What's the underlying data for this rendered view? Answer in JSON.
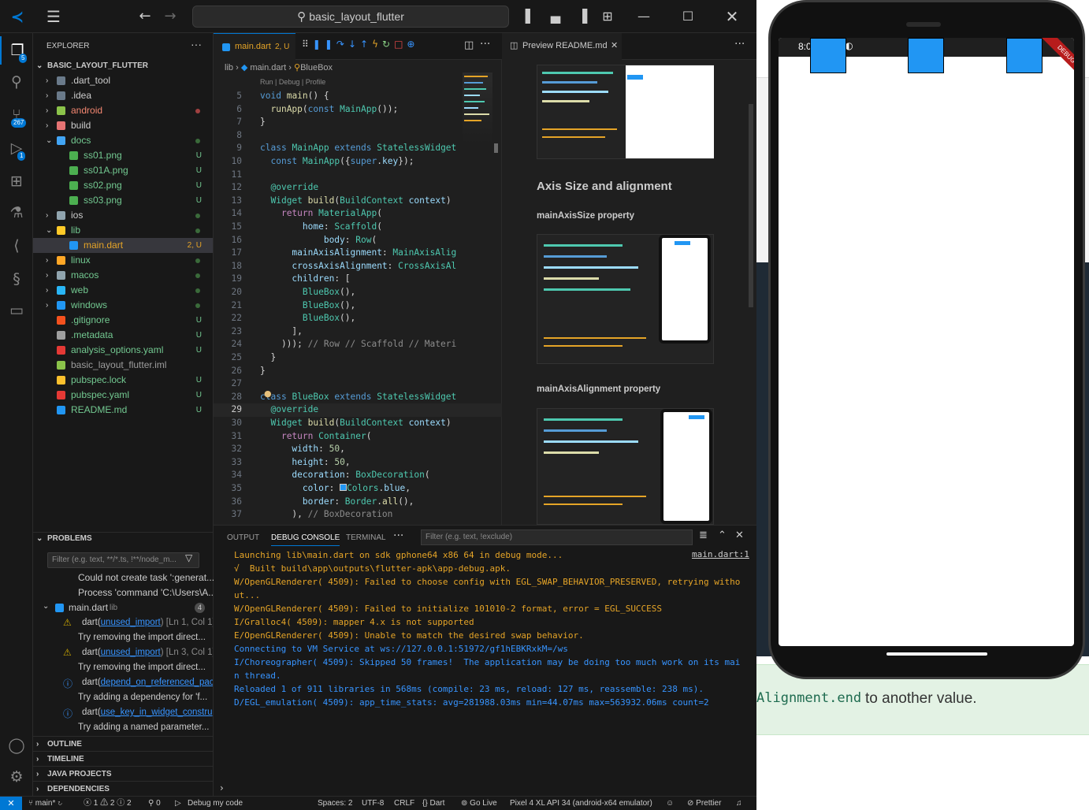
{
  "titlebar": {
    "search_text": "basic_layout_flutter"
  },
  "activity_badges": {
    "explorer": "5",
    "scm": "267",
    "debug": "1"
  },
  "explorer": {
    "header": "EXPLORER",
    "root": "BASIC_LAYOUT_FLUTTER",
    "items": [
      {
        "label": ".dart_tool",
        "status": ""
      },
      {
        "label": ".idea",
        "status": ""
      },
      {
        "label": "android",
        "status": ""
      },
      {
        "label": "build",
        "status": ""
      },
      {
        "label": "docs",
        "status": ""
      },
      {
        "label": "ss01.png",
        "status": "U"
      },
      {
        "label": "ss01A.png",
        "status": "U"
      },
      {
        "label": "ss02.png",
        "status": "U"
      },
      {
        "label": "ss03.png",
        "status": "U"
      },
      {
        "label": "ios",
        "status": ""
      },
      {
        "label": "lib",
        "status": ""
      },
      {
        "label": "main.dart",
        "status": "2, U"
      },
      {
        "label": "linux",
        "status": ""
      },
      {
        "label": "macos",
        "status": ""
      },
      {
        "label": "web",
        "status": ""
      },
      {
        "label": "windows",
        "status": ""
      },
      {
        "label": ".gitignore",
        "status": "U"
      },
      {
        "label": ".metadata",
        "status": "U"
      },
      {
        "label": "analysis_options.yaml",
        "status": "U"
      },
      {
        "label": "basic_layout_flutter.iml",
        "status": ""
      },
      {
        "label": "pubspec.lock",
        "status": "U"
      },
      {
        "label": "pubspec.yaml",
        "status": "U"
      },
      {
        "label": "README.md",
        "status": "U"
      }
    ]
  },
  "problems": {
    "header": "PROBLEMS",
    "filter_placeholder": "Filter (e.g. text, **/*.ts, !**/node_m...",
    "line1": "Could not create task ':generat...",
    "line2": "Process 'command 'C:\\Users\\A...",
    "file": "main.dart",
    "file_dir": "lib",
    "count": "4",
    "rows": [
      {
        "prefix": "dart(",
        "code": "unused_import",
        "suffix": ") [Ln 1, Col 1]"
      },
      {
        "text": "Try removing the import direct..."
      },
      {
        "prefix": "dart(",
        "code": "unused_import",
        "suffix": ") [Ln 3, Col 1]"
      },
      {
        "text": "Try removing the import direct..."
      },
      {
        "prefix": "dart(",
        "code": "depend_on_referenced_pac",
        "suffix": ""
      },
      {
        "text": "Try adding a dependency for 'f..."
      },
      {
        "prefix": "dart(",
        "code": "use_key_in_widget_constru",
        "suffix": ""
      },
      {
        "text": "Try adding a named parameter..."
      }
    ]
  },
  "bottom_sections": [
    "OUTLINE",
    "TIMELINE",
    "JAVA PROJECTS",
    "DEPENDENCIES"
  ],
  "editor": {
    "tab_label": "main.dart",
    "tab_status": "2, U",
    "breadcrumb": [
      "lib",
      "main.dart",
      "BlueBox"
    ],
    "codelens": "Run | Debug | Profile",
    "lines": [
      {
        "n": "5",
        "h": "<span class='kw'>void</span> <span class='fn'>main</span>() {"
      },
      {
        "n": "6",
        "h": "  <span class='fn'>runApp</span>(<span class='kw'>const</span> <span class='ty'>MainApp</span>());"
      },
      {
        "n": "7",
        "h": "}"
      },
      {
        "n": "8",
        "h": ""
      },
      {
        "n": "9",
        "h": "<span class='kw'>class</span> <span class='ty'>MainApp</span> <span class='kw'>extends</span> <span class='ty'>StatelessWidget</span>"
      },
      {
        "n": "10",
        "h": "  <span class='kw'>const</span> <span class='ty'>MainApp</span>({<span class='kw'>super</span>.<span class='pr'>key</span>});"
      },
      {
        "n": "11",
        "h": ""
      },
      {
        "n": "12",
        "h": "  <span class='ty'>@override</span>"
      },
      {
        "n": "13",
        "h": "  <span class='ty'>Widget</span> <span class='fn'>build</span>(<span class='ty'>BuildContext</span> <span class='pr'>context</span>) {"
      },
      {
        "n": "14",
        "h": "    <span class='kc'>return</span> <span class='ty'>MaterialApp</span>("
      },
      {
        "n": "15",
        "h": "        <span class='pr'>home</span>: <span class='ty'>Scaffold</span>("
      },
      {
        "n": "16",
        "h": "            <span class='pr'>body</span>: <span class='ty'>Row</span>("
      },
      {
        "n": "17",
        "h": "      <span class='pr'>mainAxisAlignment</span>: <span class='ty'>MainAxisAlignment</span>"
      },
      {
        "n": "18",
        "h": "      <span class='pr'>crossAxisAlignment</span>: <span class='ty'>CrossAxisAlignment</span>"
      },
      {
        "n": "19",
        "h": "      <span class='pr'>children</span>: ["
      },
      {
        "n": "20",
        "h": "        <span class='ty'>BlueBox</span>(),"
      },
      {
        "n": "21",
        "h": "        <span class='ty'>BlueBox</span>(),"
      },
      {
        "n": "22",
        "h": "        <span class='ty'>BlueBox</span>(),"
      },
      {
        "n": "23",
        "h": "      ],"
      },
      {
        "n": "24",
        "h": "    ))); <span class='cm'>// Row // Scaffold // MaterialApp</span>"
      },
      {
        "n": "25",
        "h": "  }"
      },
      {
        "n": "26",
        "h": "}"
      },
      {
        "n": "27",
        "h": ""
      },
      {
        "n": "28",
        "h": "<span class='kw'>class</span> <span class='ty'>BlueBox</span> <span class='kw'>extends</span> <span class='ty'>StatelessWidget</span>"
      },
      {
        "n": "29",
        "h": "  <span class='ty'>@override</span>"
      },
      {
        "n": "30",
        "h": "  <span class='ty'>Widget</span> <span class='fn'>build</span>(<span class='ty'>BuildContext</span> <span class='pr'>context</span>) {"
      },
      {
        "n": "31",
        "h": "    <span class='kc'>return</span> <span class='ty'>Container</span>("
      },
      {
        "n": "32",
        "h": "      <span class='pr'>width</span>: <span class='nm'>50</span>,"
      },
      {
        "n": "33",
        "h": "      <span class='pr'>height</span>: <span class='nm'>50</span>,"
      },
      {
        "n": "34",
        "h": "      <span class='pr'>decoration</span>: <span class='ty'>BoxDecoration</span>("
      },
      {
        "n": "35",
        "h": "        <span class='pr'>color</span>: <span style='display:inline-block;width:9px;height:9px;background:#2196f3;border:1px solid #ccc'></span><span class='ty'>Colors</span>.<span class='pr'>blue</span>,"
      },
      {
        "n": "36",
        "h": "        <span class='pr'>border</span>: <span class='ty'>Border</span>.<span class='fn'>all</span>(),"
      },
      {
        "n": "37",
        "h": "      ), <span class='cm'>// BoxDecoration</span>"
      }
    ]
  },
  "preview": {
    "tab_label": "Preview README.md",
    "heading": "Axis Size and alignment",
    "sub1": "mainAxisSize property",
    "sub2": "mainAxisAlignment property"
  },
  "panel": {
    "tabs": [
      "OUTPUT",
      "DEBUG CONSOLE",
      "TERMINAL"
    ],
    "filter_placeholder": "Filter (e.g. text, !exclude)",
    "source_link": "main.dart:1",
    "lines": [
      {
        "t": "Launching lib\\main.dart on sdk gphone64 x86 64 in debug mode...",
        "c": "#e5a427"
      },
      {
        "t": "√  Built build\\app\\outputs\\flutter-apk\\app-debug.apk.",
        "c": "#e5a427"
      },
      {
        "t": "W/OpenGLRenderer( 4509): Failed to choose config with EGL_SWAP_BEHAVIOR_PRESERVED, retrying witho",
        "c": "#e5a427"
      },
      {
        "t": "ut...",
        "c": "#e5a427"
      },
      {
        "t": "W/OpenGLRenderer( 4509): Failed to initialize 101010-2 format, error = EGL_SUCCESS",
        "c": "#e5a427"
      },
      {
        "t": "I/Gralloc4( 4509): mapper 4.x is not supported",
        "c": "#e5a427"
      },
      {
        "t": "E/OpenGLRenderer( 4509): Unable to match the desired swap behavior.",
        "c": "#e5a427"
      },
      {
        "t": "Connecting to VM Service at ws://127.0.0.1:51972/gf1hEBKRxkM=/ws",
        "c": "#3794ff"
      },
      {
        "t": "I/Choreographer( 4509): Skipped 50 frames!  The application may be doing too much work on its mai",
        "c": "#3794ff"
      },
      {
        "t": "n thread.",
        "c": "#3794ff"
      },
      {
        "t": "Reloaded 1 of 911 libraries in 568ms (compile: 23 ms, reload: 127 ms, reassemble: 238 ms).",
        "c": "#3794ff"
      },
      {
        "t": "D/EGL_emulation( 4509): app_time_stats: avg=281988.03ms min=44.07ms max=563932.06ms count=2",
        "c": "#3794ff"
      }
    ]
  },
  "statusbar": {
    "branch": "main*",
    "errors": "1",
    "warnings": "2",
    "infos": "2",
    "ports": "0",
    "debug": "Debug my code",
    "spaces": "Spaces: 2",
    "encoding": "UTF-8",
    "eol": "CRLF",
    "language": "Dart",
    "golive": "Go Live",
    "device": "Pixel 4 XL API 34 (android-x64 emulator)",
    "prettier": "Prettier"
  },
  "browser_bg": {
    "code": "Alignment.end",
    "text": " to another value."
  },
  "emulator": {
    "time": "8:07",
    "banner": "DEBUG"
  }
}
